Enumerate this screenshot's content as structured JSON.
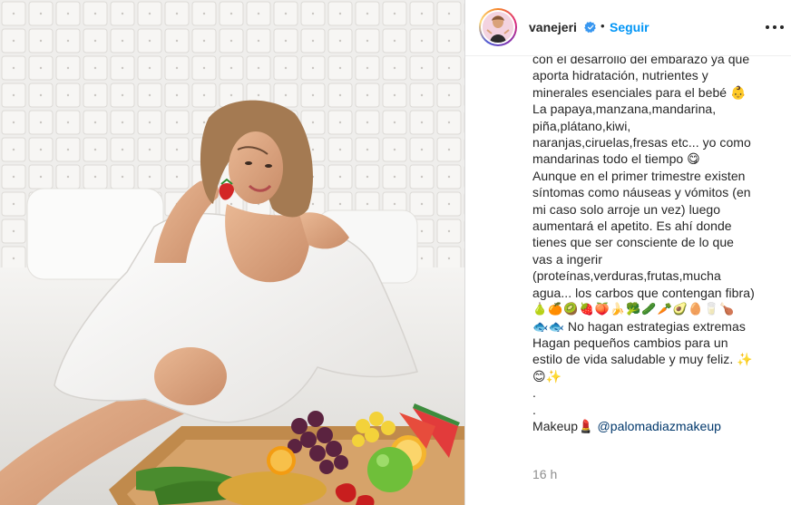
{
  "post": {
    "username": "vanejeri",
    "follow_label": "Seguir",
    "separator": "•",
    "timestamp": "16 h"
  },
  "caption": {
    "lines": [
      "con el desarrollo del embarazo ya que",
      "aporta hidratación, nutrientes y",
      "minerales esenciales para el bebé 👶",
      "La papaya,manzana,mandarina,",
      "piña,plátano,kiwi,",
      "naranjas,ciruelas,fresas etc... yo como",
      "mandarinas todo el tiempo 😋",
      "Aunque en el primer trimestre existen",
      "síntomas como náuseas y vómitos (en",
      "mi caso solo arroje un vez) luego",
      "aumentará el apetito. Es ahí donde",
      "tienes que ser consciente de lo que",
      "vas a ingerir",
      "(proteínas,verduras,frutas,mucha",
      "agua... los carbos que contengan fibra)"
    ],
    "emoji_row_1": "🍐🍊🥝🍓🍑🍌🥦🥒🥕🥑🥚🥛🍗",
    "emoji_row_2_icons": "🐟🐟",
    "emoji_row_2_text": " No hagan estrategias extremas",
    "lines_after": [
      "Hagan pequeños cambios para un",
      "estilo de vida saludable y muy feliz. ✨",
      "😊✨",
      ".",
      "."
    ],
    "makeup_label": "Makeup💄",
    "mention": "@palomadiazmakeup"
  },
  "colors": {
    "link": "#0095f6",
    "mention": "#00376b",
    "text": "#262626",
    "muted": "#8e8e8e",
    "verified": "#3897f0"
  },
  "icons": {
    "verified": "verified-badge-icon",
    "more": "more-options-icon"
  }
}
